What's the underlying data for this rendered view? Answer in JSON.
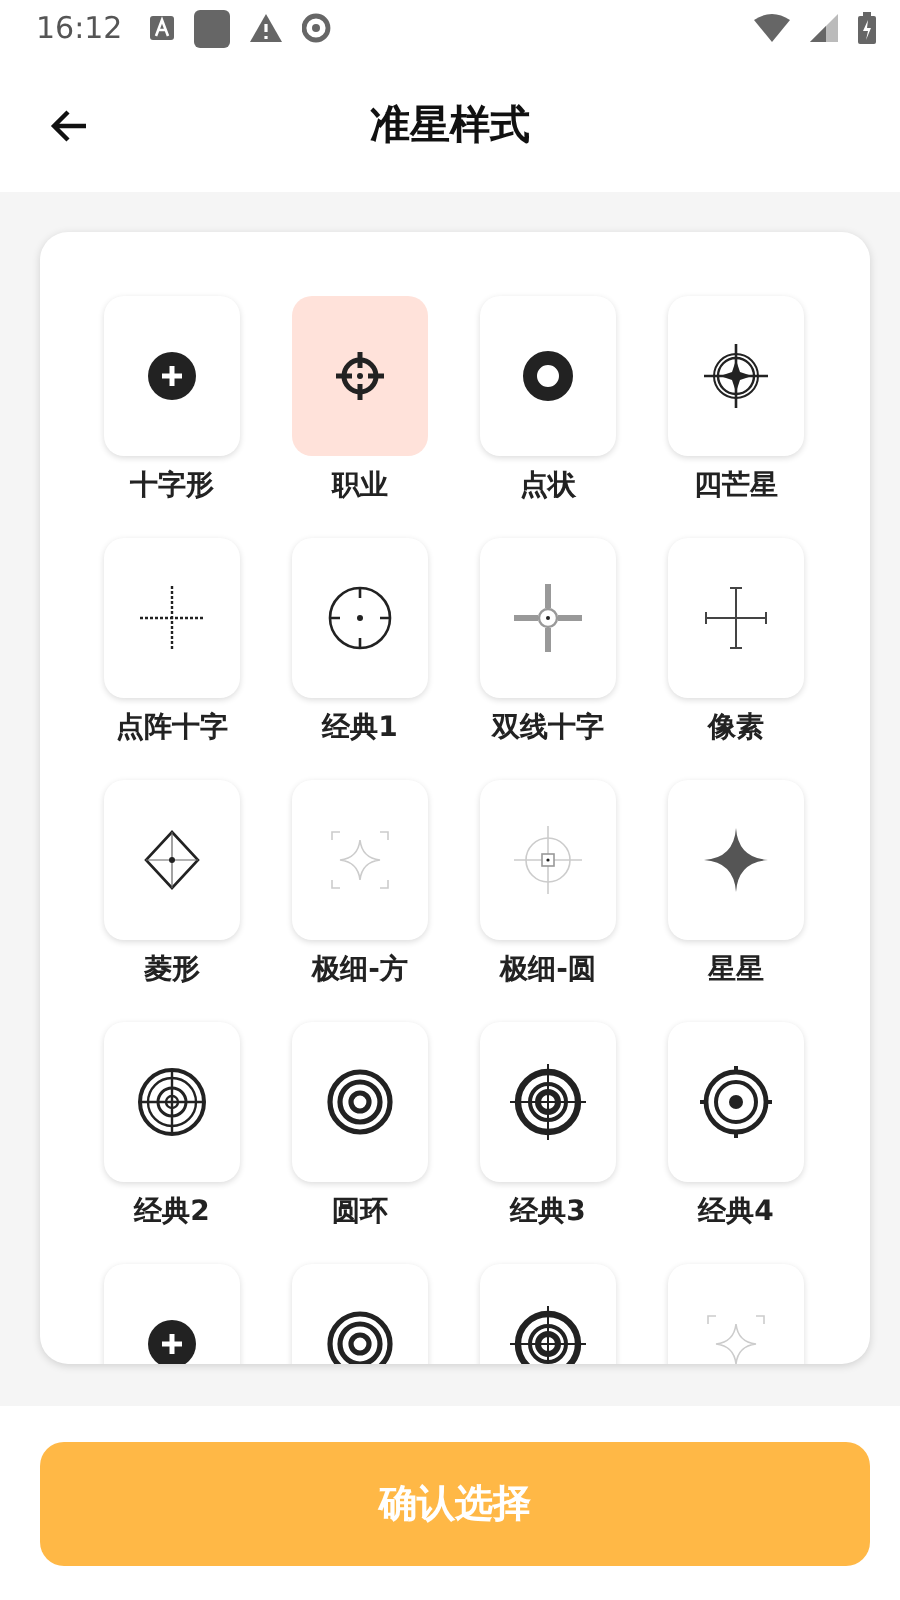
{
  "status_bar": {
    "time": "16:12"
  },
  "header": {
    "title": "准星样式"
  },
  "styles": [
    {
      "label": "十字形",
      "kind": "plus-dot",
      "selected": false
    },
    {
      "label": "职业",
      "kind": "scope",
      "selected": true
    },
    {
      "label": "点状",
      "kind": "ring-dot",
      "selected": false
    },
    {
      "label": "四芒星",
      "kind": "compass-star",
      "selected": false
    },
    {
      "label": "点阵十字",
      "kind": "dotted-cross",
      "selected": false
    },
    {
      "label": "经典1",
      "kind": "circle-cross",
      "selected": false
    },
    {
      "label": "双线十字",
      "kind": "double-cross",
      "selected": false
    },
    {
      "label": "像素",
      "kind": "pixel-cross",
      "selected": false
    },
    {
      "label": "菱形",
      "kind": "diamond",
      "selected": false
    },
    {
      "label": "极细-方",
      "kind": "thin-square",
      "selected": false
    },
    {
      "label": "极细-圆",
      "kind": "thin-circle",
      "selected": false
    },
    {
      "label": "星星",
      "kind": "star",
      "selected": false
    },
    {
      "label": "经典2",
      "kind": "target-2",
      "selected": false
    },
    {
      "label": "圆环",
      "kind": "rings",
      "selected": false
    },
    {
      "label": "经典3",
      "kind": "target-3",
      "selected": false
    },
    {
      "label": "经典4",
      "kind": "target-4",
      "selected": false
    },
    {
      "kind": "plus-dot",
      "selected": false
    },
    {
      "kind": "rings",
      "selected": false
    },
    {
      "kind": "target-3",
      "selected": false
    },
    {
      "kind": "thin-square",
      "selected": false
    }
  ],
  "confirm_button": {
    "label": "确认选择"
  }
}
